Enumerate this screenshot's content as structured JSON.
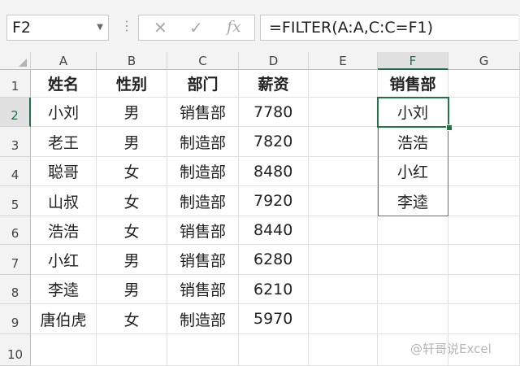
{
  "name_box": {
    "value": "F2",
    "dropdown_icon": "chevron-down-icon"
  },
  "formula_bar": {
    "cancel_icon": "✕",
    "enter_icon": "✓",
    "fx_label": "fx",
    "formula": "=FILTER(A:A,C:C=F1)"
  },
  "columns": [
    "A",
    "B",
    "C",
    "D",
    "E",
    "F",
    "G"
  ],
  "rows": [
    "1",
    "2",
    "3",
    "4",
    "5",
    "6",
    "7",
    "8",
    "9",
    "10"
  ],
  "selected_cell": {
    "column": "F",
    "row": "2"
  },
  "sheet": {
    "headers": [
      "姓名",
      "性别",
      "部门",
      "薪资"
    ],
    "records": [
      [
        "小刘",
        "男",
        "销售部",
        "7780"
      ],
      [
        "老王",
        "男",
        "制造部",
        "7820"
      ],
      [
        "聪哥",
        "女",
        "制造部",
        "8480"
      ],
      [
        "山叔",
        "女",
        "制造部",
        "7920"
      ],
      [
        "浩浩",
        "女",
        "销售部",
        "8440"
      ],
      [
        "小红",
        "男",
        "销售部",
        "6280"
      ],
      [
        "李逵",
        "男",
        "销售部",
        "6210"
      ],
      [
        "唐伯虎",
        "女",
        "制造部",
        "5970"
      ]
    ],
    "filter_header": "销售部",
    "filter_results": [
      "小刘",
      "浩浩",
      "小红",
      "李逵"
    ]
  },
  "watermark": "@轩哥说Excel"
}
